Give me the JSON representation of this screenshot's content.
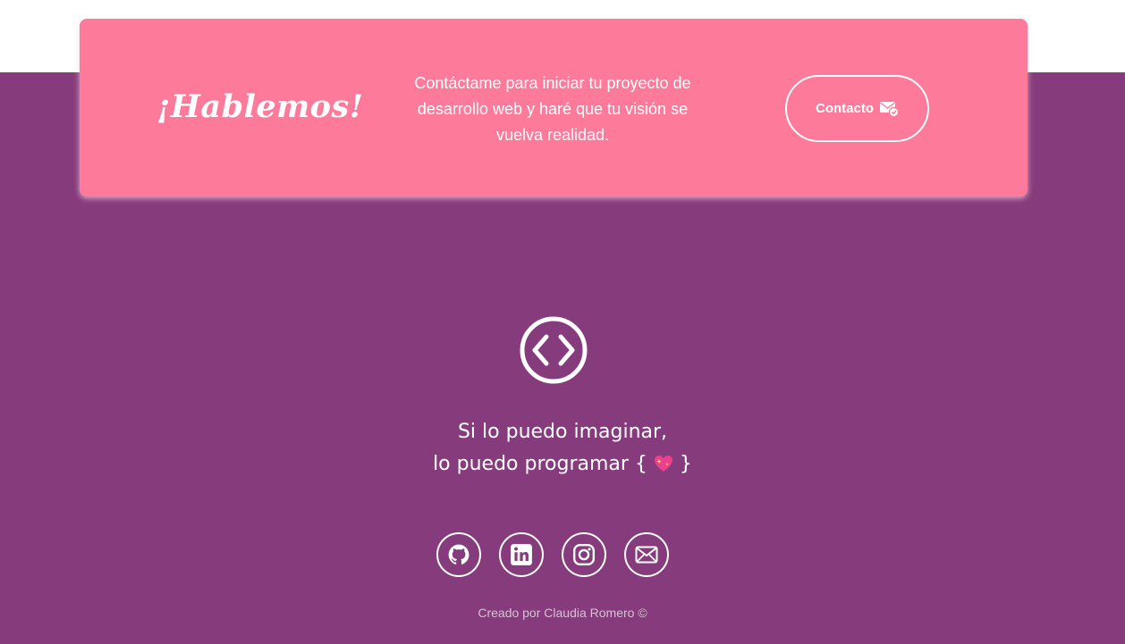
{
  "cta": {
    "title": "¡Hablemos!",
    "description": "Contáctame para iniciar tu proyecto de desarrollo web y haré que tu visión se vuelva realidad.",
    "button_label": "Contacto",
    "button_icon": "mail-check-icon"
  },
  "footer": {
    "logo_icon": "code-icon",
    "tagline_line1": "Si lo puedo imaginar,",
    "tagline_line2_prefix": "lo puedo programar {",
    "tagline_emoji": "sparkling-heart-icon",
    "tagline_line2_suffix": "}",
    "social": [
      {
        "icon": "github-icon"
      },
      {
        "icon": "linkedin-icon"
      },
      {
        "icon": "instagram-icon"
      },
      {
        "icon": "email-icon"
      }
    ],
    "credit": "Creado por Claudia Romero ©"
  },
  "colors": {
    "background_purple": "#863b7c",
    "card_pink": "#fe7a9b",
    "text_white": "#ffffff",
    "credit_text": "#d7c2d3"
  }
}
